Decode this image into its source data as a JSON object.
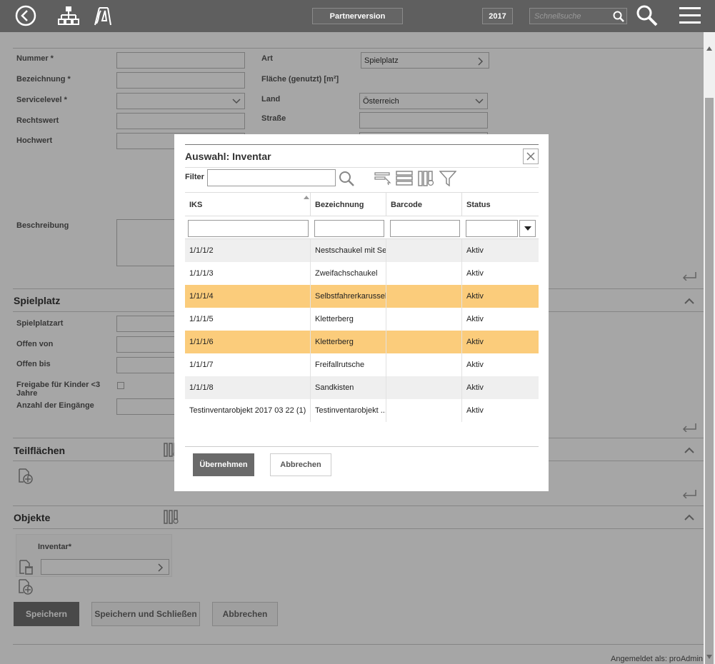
{
  "topbar": {
    "partner_label": "Partnerversion",
    "year_label": "2017",
    "search_placeholder": "Schnellsuche"
  },
  "form": {
    "fields_left": [
      {
        "label": "Nummer *"
      },
      {
        "label": "Bezeichnung *"
      },
      {
        "label": "Servicelevel *"
      },
      {
        "label": "Rechtswert"
      },
      {
        "label": "Hochwert"
      },
      {
        "label": "Beschreibung"
      }
    ],
    "art_label": "Art",
    "art_value": "Spielplatz",
    "flaeche_label": "Fläche (genutzt) [m²]",
    "land_label": "Land",
    "land_value": "Österreich",
    "strasse_label": "Straße"
  },
  "spielplatz": {
    "title": "Spielplatz",
    "spielplatzart": "Spielplatzart",
    "offen_von": "Offen von",
    "offen_bis": "Offen bis",
    "freigabe": "Freigabe für Kinder <3 Jahre",
    "eingaenge": "Anzahl der Eingänge"
  },
  "teilflaechen": {
    "title": "Teilflächen"
  },
  "objekte": {
    "title": "Objekte",
    "inventar_label": "Inventar*"
  },
  "actions": {
    "save": "Speichern",
    "save_close": "Speichern und Schließen",
    "cancel": "Abbrechen"
  },
  "footer": {
    "logged_in": "Angemeldet als: proAdmin"
  },
  "modal": {
    "title": "Auswahl: Inventar",
    "filter_label": "Filter",
    "columns": [
      "IKS",
      "Bezeichnung",
      "Barcode",
      "Status"
    ],
    "rows": [
      {
        "iks": "1/1/1/2",
        "bezeichnung": "Nestschaukel mit Seil",
        "barcode": "",
        "status": "Aktiv",
        "selected": false
      },
      {
        "iks": "1/1/1/3",
        "bezeichnung": "Zweifachschaukel",
        "barcode": "",
        "status": "Aktiv",
        "selected": false
      },
      {
        "iks": "1/1/1/4",
        "bezeichnung": "Selbstfahrerkarussell",
        "barcode": "",
        "status": "Aktiv",
        "selected": true
      },
      {
        "iks": "1/1/1/5",
        "bezeichnung": "Kletterberg",
        "barcode": "",
        "status": "Aktiv",
        "selected": false
      },
      {
        "iks": "1/1/1/6",
        "bezeichnung": "Kletterberg",
        "barcode": "",
        "status": "Aktiv",
        "selected": true
      },
      {
        "iks": "1/1/1/7",
        "bezeichnung": "Freifallrutsche",
        "barcode": "",
        "status": "Aktiv",
        "selected": false
      },
      {
        "iks": "1/1/1/8",
        "bezeichnung": "Sandkisten",
        "barcode": "",
        "status": "Aktiv",
        "selected": false
      },
      {
        "iks": "Testinventarobjekt 2017 03 22 (1)",
        "bezeichnung": "Testinventarobjekt ...",
        "barcode": "",
        "status": "Aktiv",
        "selected": false
      }
    ],
    "ok_label": "Übernehmen",
    "cancel_label": "Abbrechen"
  },
  "colors": {
    "topbar": "#5f5f5f",
    "selected_row": "#fbcc7b",
    "primary_button": "#6a6a6a"
  }
}
